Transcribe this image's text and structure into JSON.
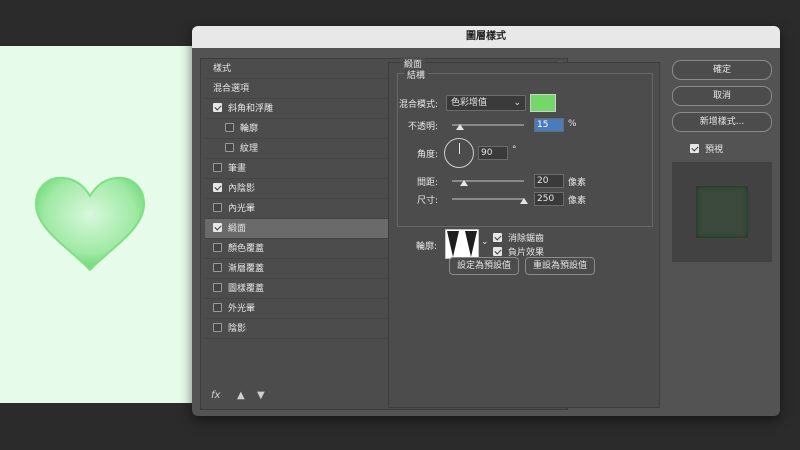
{
  "dialog": {
    "title": "圖層樣式",
    "styles": [
      {
        "label": "樣式",
        "checkbox": false,
        "checked": false,
        "sub": false,
        "plus": false,
        "selected": false
      },
      {
        "label": "混合選項",
        "checkbox": false,
        "checked": false,
        "sub": false,
        "plus": false,
        "selected": false
      },
      {
        "label": "斜角和浮雕",
        "checkbox": true,
        "checked": true,
        "sub": false,
        "plus": false,
        "selected": false
      },
      {
        "label": "輪廓",
        "checkbox": true,
        "checked": false,
        "sub": true,
        "plus": false,
        "selected": false
      },
      {
        "label": "紋理",
        "checkbox": true,
        "checked": false,
        "sub": true,
        "plus": false,
        "selected": false
      },
      {
        "label": "筆畫",
        "checkbox": true,
        "checked": false,
        "sub": false,
        "plus": true,
        "selected": false
      },
      {
        "label": "內陰影",
        "checkbox": true,
        "checked": true,
        "sub": false,
        "plus": true,
        "selected": false
      },
      {
        "label": "內光暈",
        "checkbox": true,
        "checked": false,
        "sub": false,
        "plus": false,
        "selected": false
      },
      {
        "label": "緞面",
        "checkbox": true,
        "checked": true,
        "sub": false,
        "plus": false,
        "selected": true
      },
      {
        "label": "顏色覆蓋",
        "checkbox": true,
        "checked": false,
        "sub": false,
        "plus": true,
        "selected": false
      },
      {
        "label": "漸層覆蓋",
        "checkbox": true,
        "checked": false,
        "sub": false,
        "plus": true,
        "selected": false
      },
      {
        "label": "圖樣覆蓋",
        "checkbox": true,
        "checked": false,
        "sub": false,
        "plus": false,
        "selected": false
      },
      {
        "label": "外光暈",
        "checkbox": true,
        "checked": false,
        "sub": false,
        "plus": false,
        "selected": false
      },
      {
        "label": "陰影",
        "checkbox": true,
        "checked": false,
        "sub": false,
        "plus": true,
        "selected": false
      }
    ],
    "bottom_icons": {
      "fx": "fx",
      "up": "▲",
      "down": "▼",
      "trash": "🗑"
    },
    "satin": {
      "group_title": "緞面",
      "structure_title": "結構",
      "blend_mode_label": "混合模式:",
      "blend_mode_value": "色彩增值",
      "blend_color": "#72d867",
      "opacity_label": "不透明:",
      "opacity_value": "15",
      "opacity_unit": "%",
      "angle_label": "角度:",
      "angle_value": "90",
      "angle_unit": "°",
      "distance_label": "間距:",
      "distance_value": "20",
      "distance_unit": "像素",
      "size_label": "尺寸:",
      "size_value": "250",
      "size_unit": "像素",
      "contour_label": "輪廓:",
      "anti_alias_label": "消除鋸齒",
      "anti_alias_checked": true,
      "invert_label": "負片效果",
      "invert_checked": true,
      "make_default_label": "設定為預設值",
      "reset_default_label": "重設為預設值"
    },
    "buttons": {
      "ok": "確定",
      "cancel": "取消",
      "new_style": "新增樣式...",
      "preview_label": "預視",
      "preview_checked": true
    }
  }
}
